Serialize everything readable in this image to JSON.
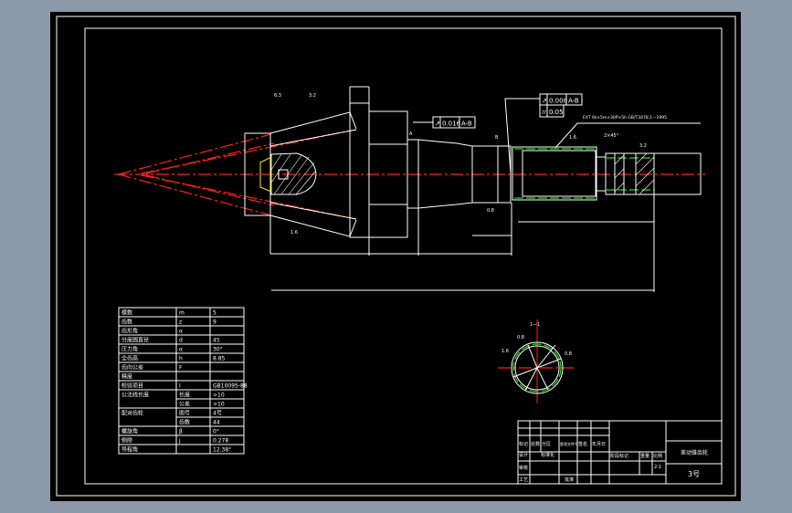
{
  "colors": {
    "background": "#8c99a9",
    "canvas": "#000000",
    "lines": "#ffffff",
    "centerline": "#ff2020",
    "pitch_line": "#22dd22",
    "highlight": "#ffee00"
  },
  "drawing": {
    "tolerances": [
      {
        "symbol": "↗",
        "value": "0.016",
        "datum": "A-B"
      },
      {
        "symbol": "↗",
        "value": "0.008",
        "datum": "A-B"
      },
      {
        "symbol": "⌭",
        "value": "0.05"
      }
    ],
    "roughness": [
      "6.3",
      "3.2",
      "1.6",
      "3.2",
      "1.6",
      "0.8"
    ],
    "datum_labels": [
      "A",
      "B"
    ],
    "spline_note": "EXT 9z×5m×30P×5h GB/T3478.1—1995",
    "chamfer_note": "2×45°",
    "section_label": "1—1",
    "section_marks": [
      "0.8",
      "1.6",
      "0.8"
    ]
  },
  "parameter_table": {
    "rows": [
      {
        "name": "模数",
        "symbol": "m",
        "value": "5"
      },
      {
        "name": "齿数",
        "symbol": "z",
        "value": "9"
      },
      {
        "name": "齿形角",
        "symbol": "α",
        "value": ""
      },
      {
        "name": "分度圆直径",
        "symbol": "d",
        "value": "45"
      },
      {
        "name": "压力角",
        "symbol": "α",
        "value": "30°"
      },
      {
        "name": "全齿高",
        "symbol": "h",
        "value": "8.85"
      },
      {
        "name": "齿向公差",
        "symbol": "F",
        "value": ""
      },
      {
        "name": "精度",
        "symbol": "",
        "value": ""
      },
      {
        "name": "检验项目",
        "symbol": "I",
        "value": "GB10095-88"
      },
      {
        "name": "公法线长度",
        "symbol": "长度",
        "value": ">10"
      },
      {
        "name": "",
        "symbol": "公差",
        "value": ">10"
      },
      {
        "name": "配对齿轮",
        "symbol": "图号",
        "value": "4号"
      },
      {
        "name": "",
        "symbol": "齿数",
        "value": "44"
      },
      {
        "name": "螺旋角",
        "symbol": "β",
        "value": "0°"
      },
      {
        "name": "侧隙",
        "symbol": "j",
        "value": "0.278"
      },
      {
        "name": "导程角",
        "symbol": "",
        "value": "12.38°"
      }
    ]
  },
  "title_block": {
    "header": [
      "标记",
      "处数",
      "分区",
      "更改文件号",
      "签名",
      "年月日"
    ],
    "design": "设计",
    "standard": "标准化",
    "stage": "阶段标记",
    "weight": "重量",
    "scale_label": "比例",
    "scale": "2:1",
    "review": "审核",
    "craft": "工艺",
    "approve": "批准",
    "part_name": "差动锥齿轮",
    "drawing_no": "3号"
  }
}
